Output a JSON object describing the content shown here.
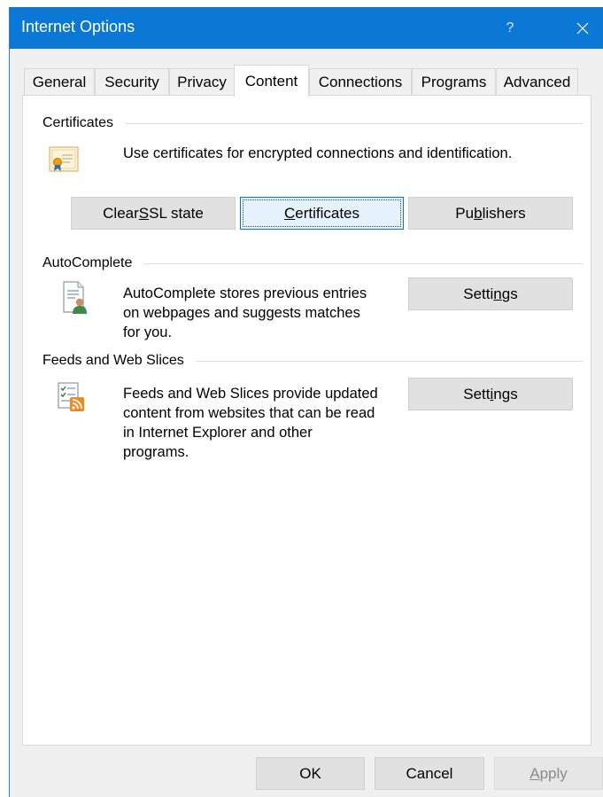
{
  "window": {
    "title": "Internet Options",
    "help_label": "?"
  },
  "tabs": [
    "General",
    "Security",
    "Privacy",
    "Content",
    "Connections",
    "Programs",
    "Advanced"
  ],
  "active_tab": "Content",
  "certificates": {
    "header": "Certificates",
    "description": "Use certificates for encrypted connections and identification.",
    "buttons": {
      "clear_ssl_pre": "Clear ",
      "clear_ssl_key": "S",
      "clear_ssl_post": "SL state",
      "certificates_pre": "",
      "certificates_key": "C",
      "certificates_post": "ertificates",
      "publishers_pre": "Pu",
      "publishers_key": "b",
      "publishers_post": "lishers"
    }
  },
  "autocomplete": {
    "header": "AutoComplete",
    "description_lines": [
      "AutoComplete stores previous entries",
      "on webpages and suggests matches",
      "for you."
    ],
    "settings_pre": "Setti",
    "settings_key": "n",
    "settings_post": "gs"
  },
  "feeds": {
    "header": "Feeds and Web Slices",
    "description_lines": [
      "Feeds and Web Slices provide updated",
      "content from websites that can be read",
      "in Internet Explorer and other",
      "programs."
    ],
    "settings_pre": "Sett",
    "settings_key": "i",
    "settings_post": "ngs"
  },
  "footer": {
    "ok": "OK",
    "cancel": "Cancel",
    "apply_pre": "",
    "apply_key": "A",
    "apply_post": "pply"
  },
  "colors": {
    "titlebar": "#0a78d4",
    "focus_border": "#0078d7",
    "button_face": "#e1e1e1"
  }
}
